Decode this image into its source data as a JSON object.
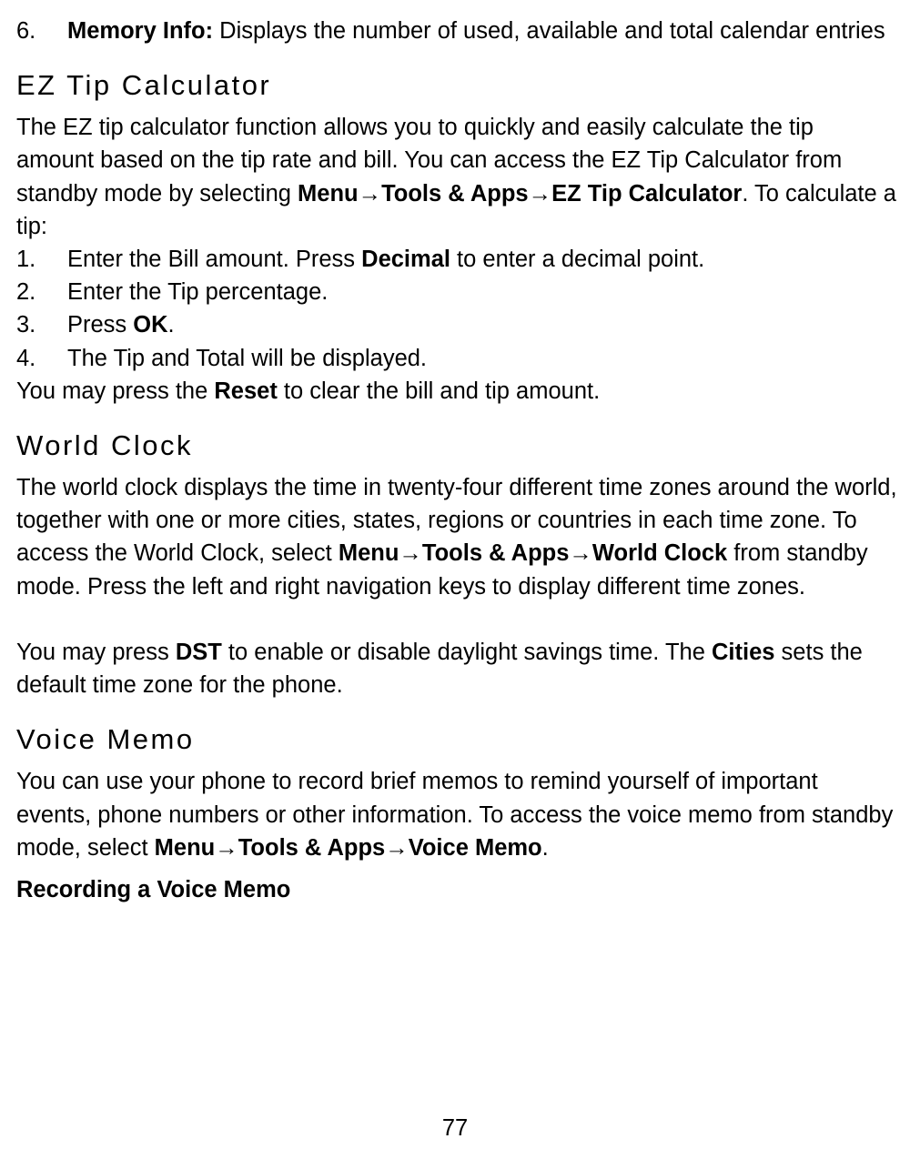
{
  "topList": {
    "num": "6.",
    "boldLabel": "Memory Info:",
    "rest": " Displays the number of used, available and total calendar entries"
  },
  "sections": {
    "ezTip": {
      "heading": "EZ Tip Calculator",
      "intro": [
        {
          "t": "The EZ tip calculator function allows you to quickly and easily calculate the tip amount based on the tip rate and bill. You can access the EZ Tip Calculator from standby mode by selecting ",
          "b": false
        },
        {
          "t": "Menu",
          "b": true
        },
        {
          "t": "→",
          "b": false
        },
        {
          "t": "Tools & Apps",
          "b": true
        },
        {
          "t": "→",
          "b": false
        },
        {
          "t": "EZ Tip Calculator",
          "b": true
        },
        {
          "t": ". To calculate a tip:",
          "b": false
        }
      ],
      "steps": [
        {
          "num": "1.",
          "parts": [
            {
              "t": "Enter the Bill amount. Press ",
              "b": false
            },
            {
              "t": "Decimal",
              "b": true
            },
            {
              "t": " to enter a decimal point.",
              "b": false
            }
          ]
        },
        {
          "num": "2.",
          "parts": [
            {
              "t": "Enter the Tip percentage.",
              "b": false
            }
          ]
        },
        {
          "num": "3.",
          "parts": [
            {
              "t": "Press ",
              "b": false
            },
            {
              "t": "OK",
              "b": true
            },
            {
              "t": ".",
              "b": false
            }
          ]
        },
        {
          "num": "4.",
          "parts": [
            {
              "t": "The Tip and Total will be displayed.",
              "b": false
            }
          ]
        }
      ],
      "after": [
        {
          "t": "You may press the ",
          "b": false
        },
        {
          "t": "Reset",
          "b": true
        },
        {
          "t": " to clear the bill and tip amount.",
          "b": false
        }
      ]
    },
    "worldClock": {
      "heading": "World Clock",
      "p1": [
        {
          "t": "The world clock displays the time in twenty-four different time zones around the world, together with one or more cities, states, regions or countries in each time zone. To access the World Clock, select ",
          "b": false
        },
        {
          "t": "Menu",
          "b": true
        },
        {
          "t": "→",
          "b": false
        },
        {
          "t": "Tools & Apps",
          "b": true
        },
        {
          "t": "→",
          "b": false
        },
        {
          "t": "World Clock",
          "b": true
        },
        {
          "t": " from standby mode. Press the left and right navigation keys to display different time zones.",
          "b": false
        }
      ],
      "p2": [
        {
          "t": "You may press ",
          "b": false
        },
        {
          "t": "DST",
          "b": true
        },
        {
          "t": " to enable or disable daylight savings time. The ",
          "b": false
        },
        {
          "t": "Cities",
          "b": true
        },
        {
          "t": " sets the default time zone for the phone.",
          "b": false
        }
      ]
    },
    "voiceMemo": {
      "heading": "Voice Memo",
      "p1": [
        {
          "t": "You can use your phone to record brief memos to remind yourself of important events, phone numbers or other information. To access the voice memo from standby mode, select ",
          "b": false
        },
        {
          "t": "Menu",
          "b": true
        },
        {
          "t": "→",
          "b": false
        },
        {
          "t": "Tools & Apps",
          "b": true
        },
        {
          "t": "→",
          "b": false
        },
        {
          "t": "Voice Memo",
          "b": true
        },
        {
          "t": ".",
          "b": false
        }
      ],
      "subhead": "Recording a Voice Memo"
    }
  },
  "pageNumber": "77"
}
